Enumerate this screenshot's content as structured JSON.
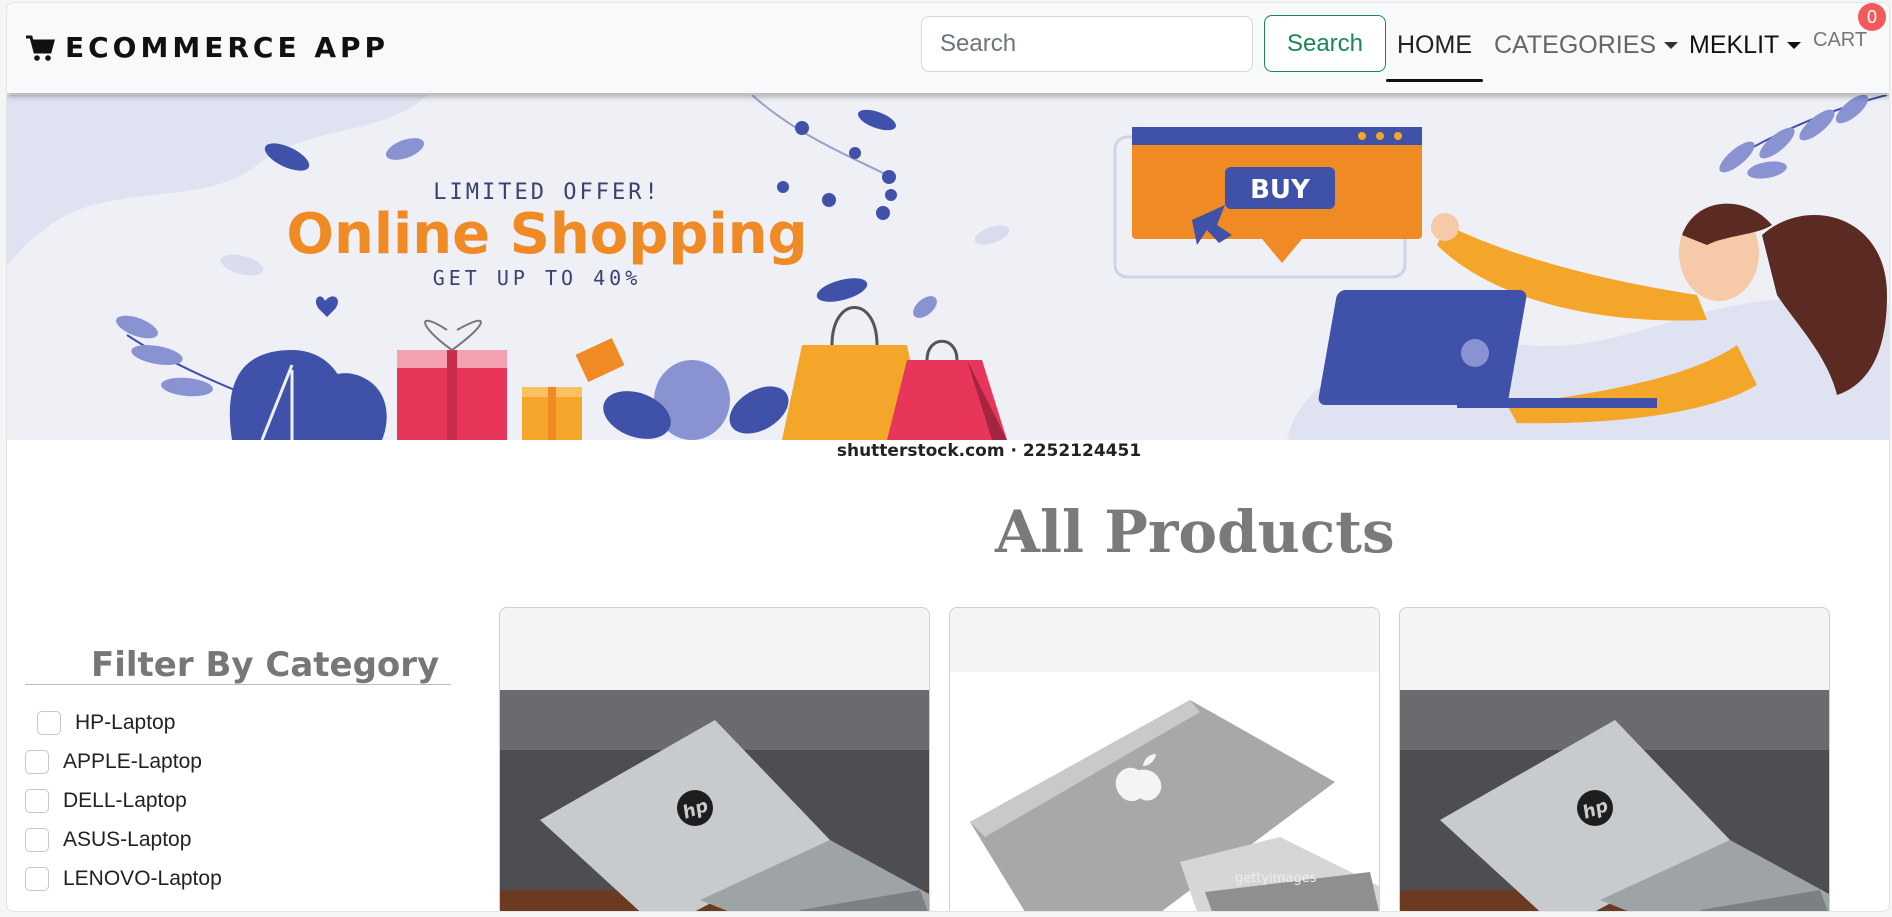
{
  "navbar": {
    "brand": "ECOMMERCE APP",
    "brand_icon": "cart-icon",
    "search_placeholder": "Search",
    "search_button": "Search",
    "links": {
      "home": "HOME",
      "categories": "CATEGORIES",
      "user": "MEKLIT",
      "cart": "CART"
    },
    "cart_count": "0"
  },
  "banner": {
    "kicker": "LIMITED OFFER!",
    "headline": "Online Shopping",
    "sub": "GET UP TO 40%",
    "buy_label": "BUY",
    "caption": "shutterstock.com · 2252124451"
  },
  "main": {
    "title": "All Products",
    "filter_title": "Filter By Category",
    "categories": [
      "HP-Laptop",
      "APPLE-Laptop",
      "DELL-Laptop",
      "ASUS-Laptop",
      "LENOVO-Laptop"
    ]
  },
  "products": [
    {
      "image": "hp-laptop-photo"
    },
    {
      "image": "apple-laptop-photo",
      "watermark": "gettyimages"
    },
    {
      "image": "hp-laptop-photo"
    }
  ],
  "colors": {
    "success": "#198754",
    "badge": "#f05a5a",
    "banner_orange": "#f08a24",
    "banner_blue": "#3f51a8"
  }
}
